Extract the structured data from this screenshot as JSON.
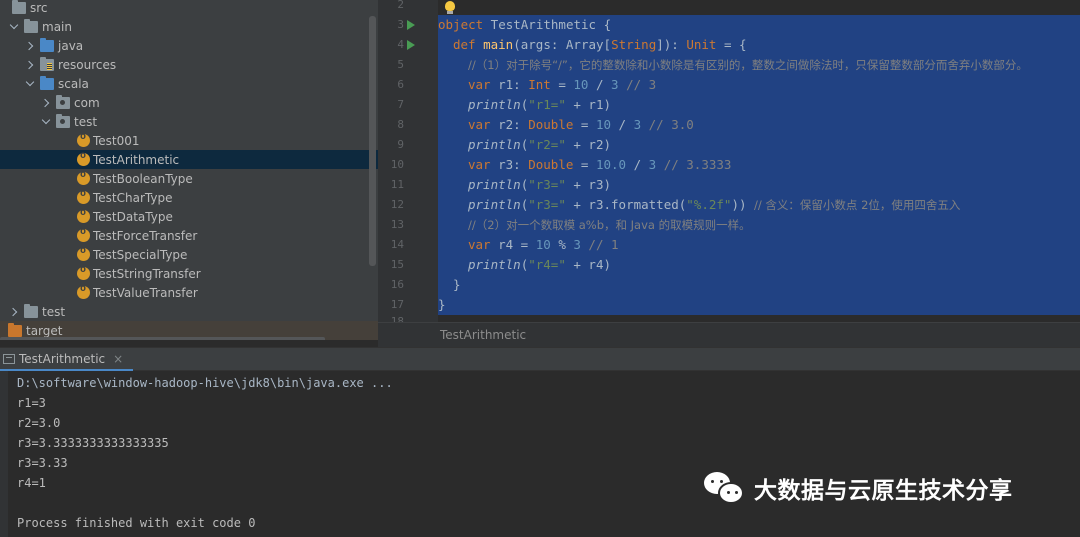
{
  "project_tree": {
    "items": [
      {
        "label": "src",
        "chevron": "none",
        "icon": "folder-icon"
      },
      {
        "label": "main",
        "chevron": "down",
        "icon": "folder-icon"
      },
      {
        "label": "java",
        "chevron": "right",
        "icon": "source-folder-icon"
      },
      {
        "label": "resources",
        "chevron": "right",
        "icon": "resources-folder-icon"
      },
      {
        "label": "scala",
        "chevron": "down",
        "icon": "source-folder-icon"
      },
      {
        "label": "com",
        "chevron": "right",
        "icon": "package-icon"
      },
      {
        "label": "test",
        "chevron": "down",
        "icon": "package-icon"
      },
      {
        "label": "Test001",
        "chevron": "none",
        "icon": "scala-object-icon"
      },
      {
        "label": "TestArithmetic",
        "chevron": "none",
        "icon": "scala-object-icon",
        "selected": true
      },
      {
        "label": "TestBooleanType",
        "chevron": "none",
        "icon": "scala-object-icon"
      },
      {
        "label": "TestCharType",
        "chevron": "none",
        "icon": "scala-object-icon"
      },
      {
        "label": "TestDataType",
        "chevron": "none",
        "icon": "scala-object-icon"
      },
      {
        "label": "TestForceTransfer",
        "chevron": "none",
        "icon": "scala-object-icon"
      },
      {
        "label": "TestSpecialType",
        "chevron": "none",
        "icon": "scala-object-icon"
      },
      {
        "label": "TestStringTransfer",
        "chevron": "none",
        "icon": "scala-object-icon"
      },
      {
        "label": "TestValueTransfer",
        "chevron": "none",
        "icon": "scala-object-icon"
      },
      {
        "label": "test",
        "chevron": "right",
        "icon": "folder-icon"
      },
      {
        "label": "target",
        "chevron": "none",
        "icon": "target-folder-icon"
      }
    ]
  },
  "editor": {
    "line_numbers": [
      "2",
      "3",
      "4",
      "5",
      "6",
      "7",
      "8",
      "9",
      "10",
      "11",
      "12",
      "13",
      "14",
      "15",
      "16",
      "17",
      "18"
    ],
    "run_marker_lines": [
      "3",
      "4"
    ],
    "tokens": {
      "l3_kw": "object",
      "l3_rest": " TestArithmetic {",
      "l4_kw": "def",
      "l4_fn": "main",
      "l4_a": "(args: Array[",
      "l4_typ": "String",
      "l4_b": "]): ",
      "l4_ret": "Unit",
      "l4_c": " = {",
      "l5_cm": "//（1）对于除号“/”，它的整数除和小数除是有区别的，整数之间做除法时，只保留整数部分而舍弃小数部分。",
      "l6_kw": "var",
      "l6_a": " r1: ",
      "l6_typ": "Int",
      "l6_b": " = ",
      "l6_n1": "10",
      "l6_c": " / ",
      "l6_n2": "3",
      "l6_cm": " // 3",
      "l7_fn": "println",
      "l7_a": "(",
      "l7_str": "\"r1=\"",
      "l7_b": " + r1)",
      "l8_kw": "var",
      "l8_a": " r2: ",
      "l8_typ": "Double",
      "l8_b": " = ",
      "l8_n1": "10",
      "l8_c": " / ",
      "l8_n2": "3",
      "l8_cm": " // 3.0",
      "l9_fn": "println",
      "l9_a": "(",
      "l9_str": "\"r2=\"",
      "l9_b": " + r2)",
      "l10_kw": "var",
      "l10_a": " r3: ",
      "l10_typ": "Double",
      "l10_b": " = ",
      "l10_n1": "10.0",
      "l10_c": " / ",
      "l10_n2": "3",
      "l10_cm": " // 3.3333",
      "l11_fn": "println",
      "l11_a": "(",
      "l11_str": "\"r3=\"",
      "l11_b": " + r3)",
      "l12_fn": "println",
      "l12_a": "(",
      "l12_str": "\"r3=\"",
      "l12_b": " + r3.formatted(",
      "l12_str2": "\"%.2f\"",
      "l12_c": ")) ",
      "l12_cm": "// 含义：保留小数点 2位，使用四舍五入",
      "l13_cm": "//（2）对一个数取模 a%b，和 Java 的取模规则一样。",
      "l14_kw": "var",
      "l14_a": " r4 = ",
      "l14_n1": "10",
      "l14_b": " % ",
      "l14_n2": "3",
      "l14_cm": " // 1",
      "l15_fn": "println",
      "l15_a": "(",
      "l15_str": "\"r4=\"",
      "l15_b": " + r4)",
      "l16": "}",
      "l17": "}"
    },
    "breadcrumb": "TestArithmetic"
  },
  "run_panel": {
    "tab_label": "TestArithmetic",
    "close_glyph": "×",
    "console_lines": [
      "D:\\software\\window-hadoop-hive\\jdk8\\bin\\java.exe ...",
      "r1=3",
      "r2=3.0",
      "r3=3.3333333333333335",
      "r3=3.33",
      "r4=1",
      "",
      "Process finished with exit code 0"
    ]
  },
  "watermark": {
    "text": "大数据与云原生技术分享",
    "icon": "wechat-icon"
  },
  "colors": {
    "selection": "#214283",
    "keyword": "#cc7832",
    "string": "#6a8759",
    "number": "#6897bb",
    "comment": "#808080",
    "function": "#ffc66d"
  }
}
